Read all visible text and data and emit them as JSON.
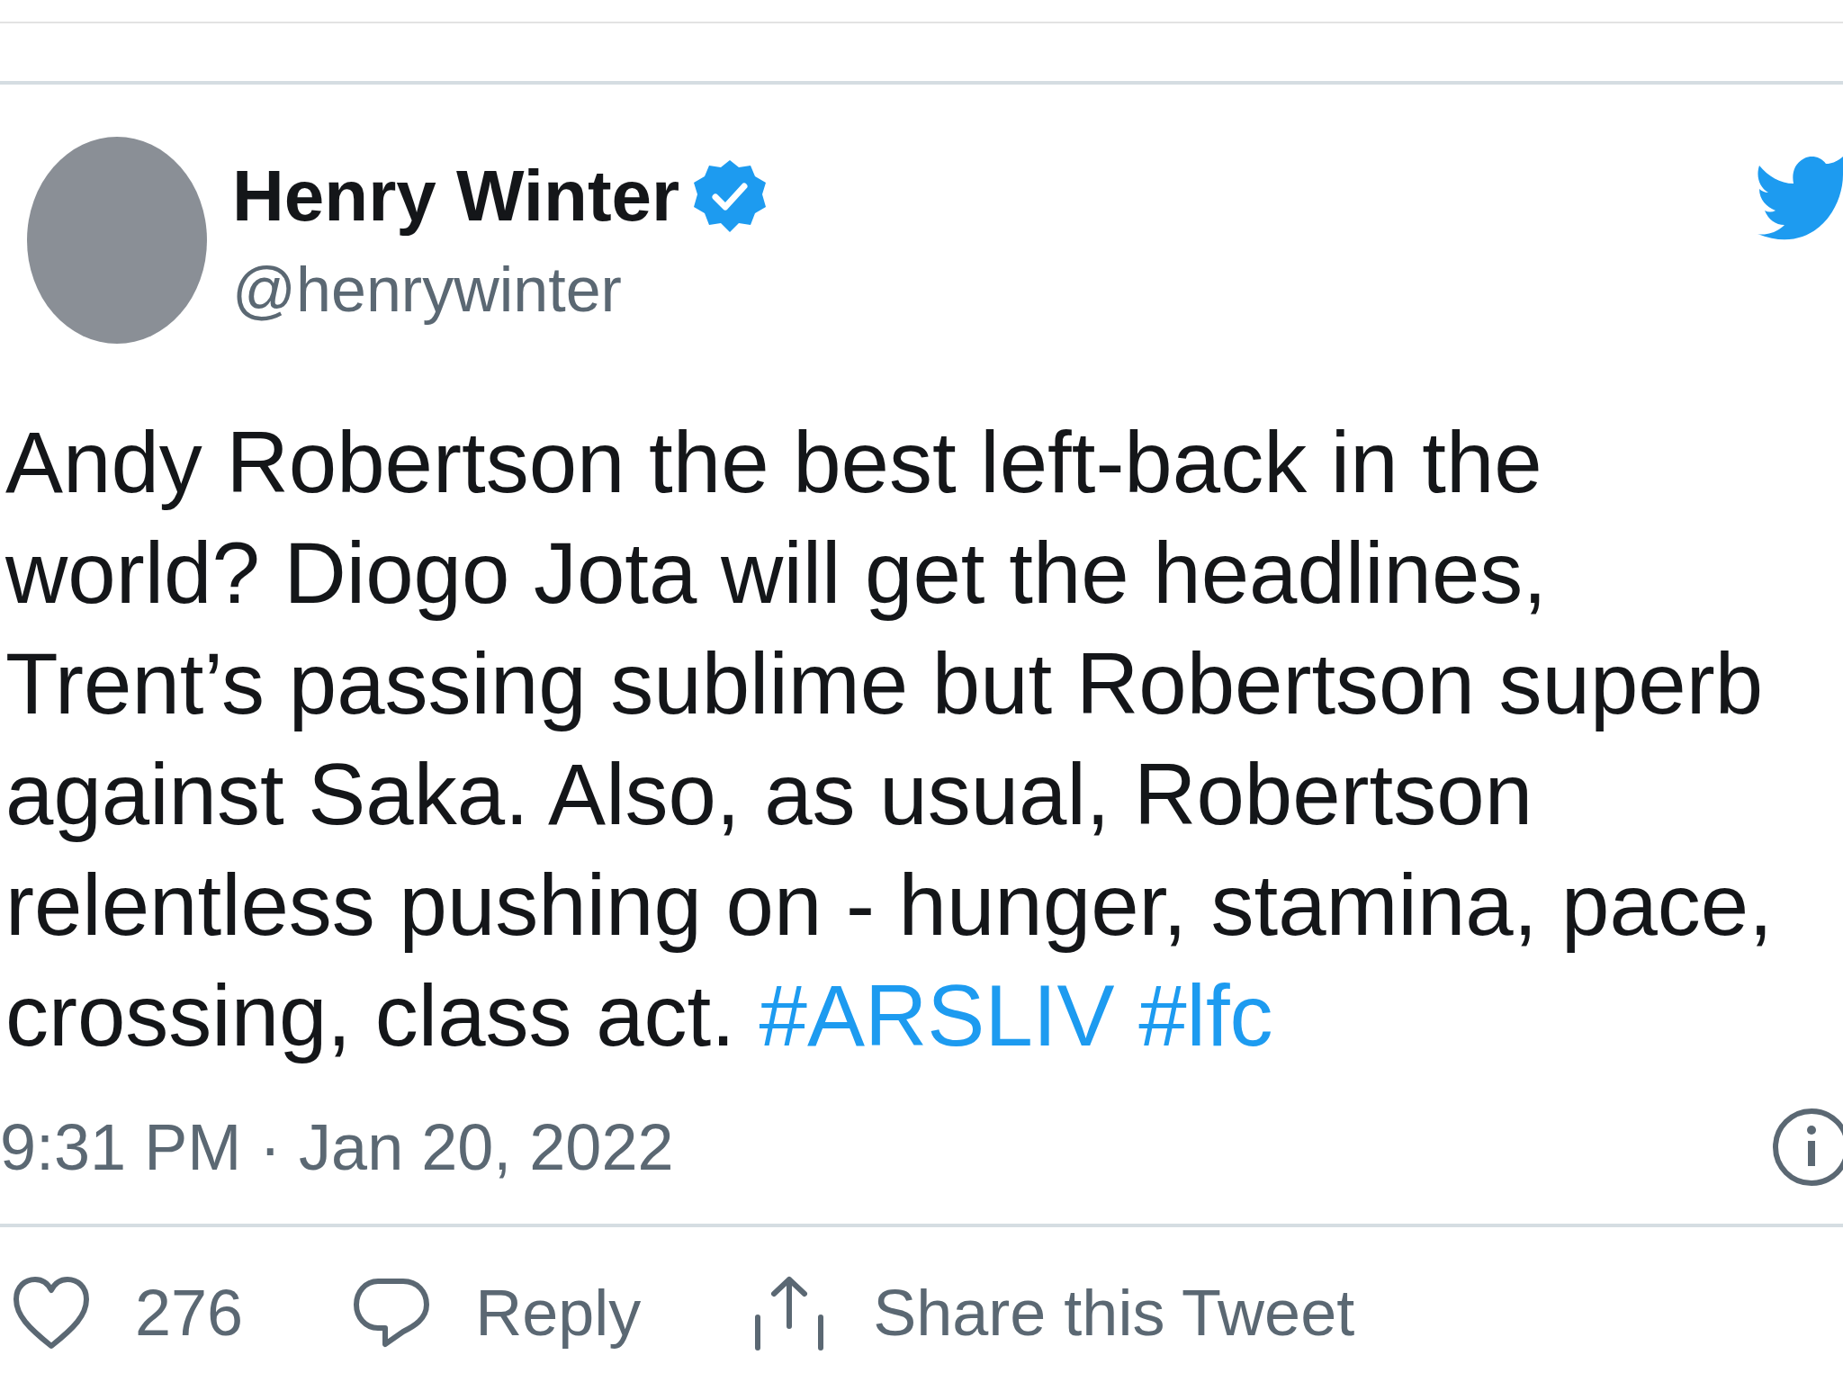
{
  "author": {
    "name": "Henry Winter",
    "verified": true,
    "handle": "@henrywinter"
  },
  "tweet": {
    "text": "Andy Robertson the best left-back in the world? Diogo Jota will get the headlines, Trent’s passing sublime but Robertson superb against Saka. Also, as usual, Robertson relentless pushing on - hunger, stamina, pace, crossing, class act.",
    "hashtags": [
      "#ARSLIV",
      "#lfc"
    ]
  },
  "timestamp": "9:31 PM · Jan 20, 2022",
  "actions": [
    {
      "kind": "like",
      "label": "276"
    },
    {
      "kind": "reply",
      "label": "Reply"
    },
    {
      "kind": "share",
      "label": "Share this Tweet"
    }
  ]
}
